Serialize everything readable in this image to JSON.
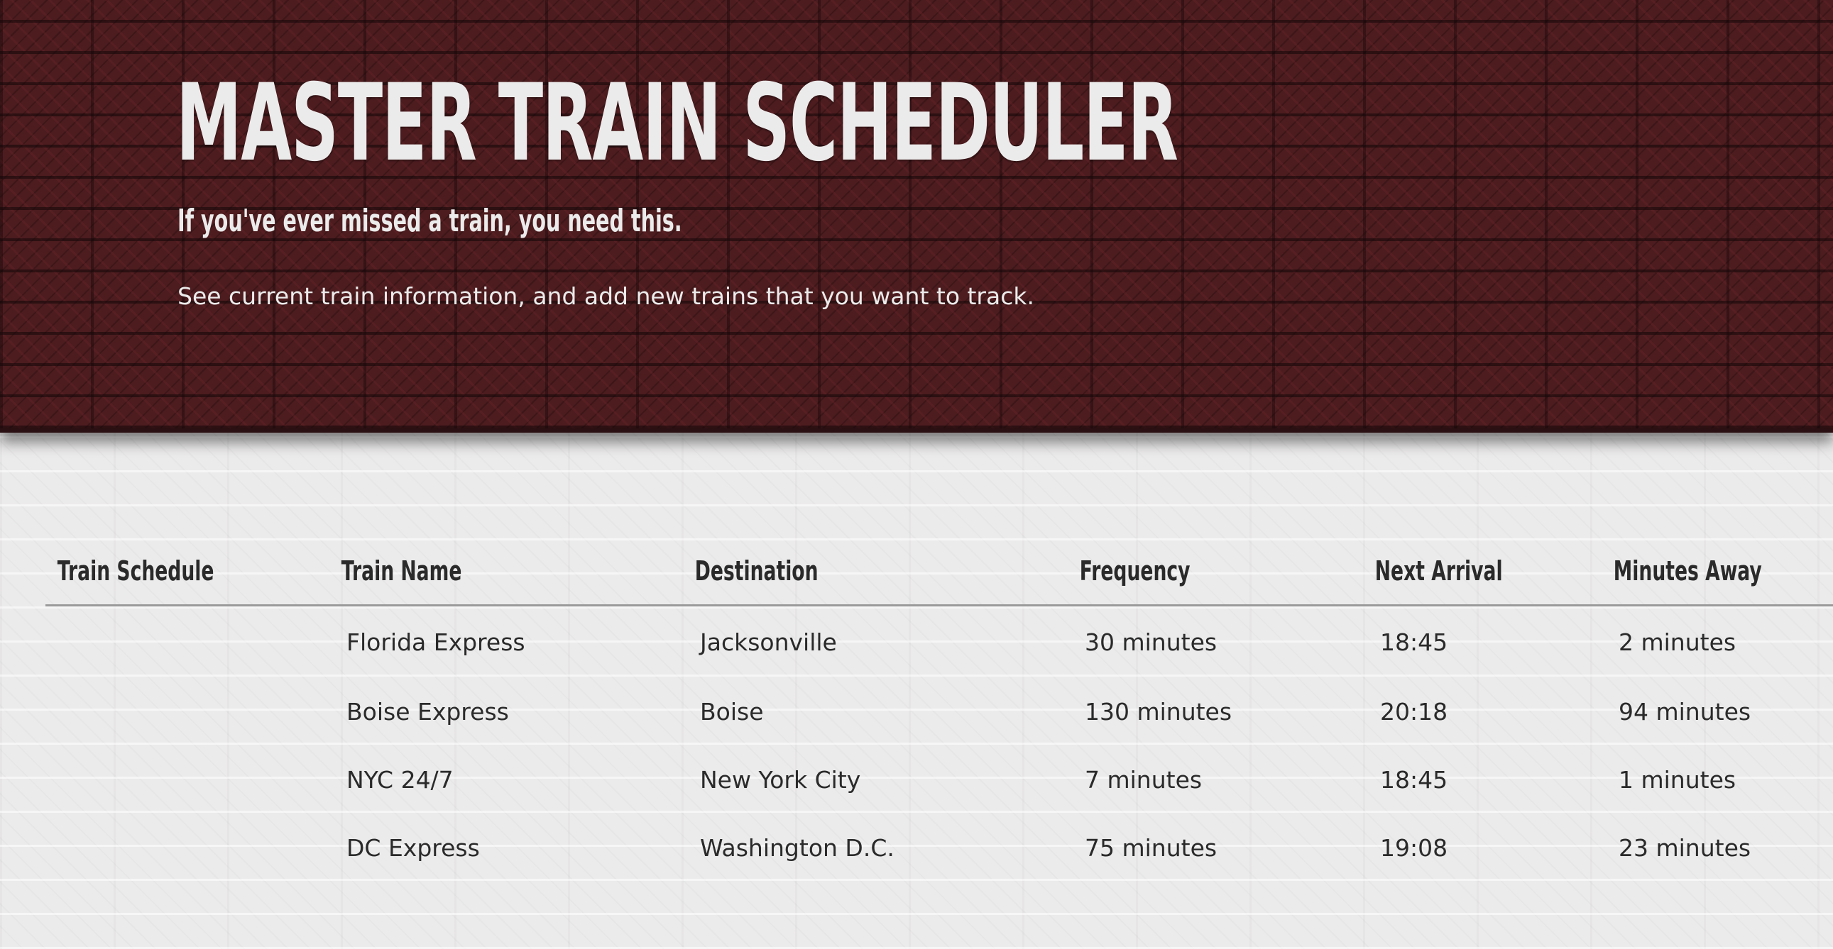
{
  "header": {
    "title": "MASTER TRAIN SCHEDULER",
    "tagline": "If you've ever missed a train, you need this.",
    "description": "See current train information, and add new trains that you want to track."
  },
  "schedule": {
    "section_label": "Train Schedule",
    "columns": [
      "Train Name",
      "Destination",
      "Frequency",
      "Next Arrival",
      "Minutes Away"
    ],
    "rows": [
      [
        "Florida Express",
        "Jacksonville",
        "30 minutes",
        "18:45",
        "2 minutes"
      ],
      [
        "Boise Express",
        "Boise",
        "130 minutes",
        "20:18",
        "94 minutes"
      ],
      [
        "NYC 24/7",
        "New York City",
        "7 minutes",
        "18:45",
        "1 minutes"
      ],
      [
        "DC Express",
        "Washington D.C.",
        "75 minutes",
        "19:08",
        "23 minutes"
      ]
    ]
  },
  "colors": {
    "hero_background": "#4c1c1f",
    "page_background": "#ecebeb",
    "text_light": "#ecebeb",
    "text_dark": "#2a2a2a",
    "rule": "#9a9a9a"
  }
}
